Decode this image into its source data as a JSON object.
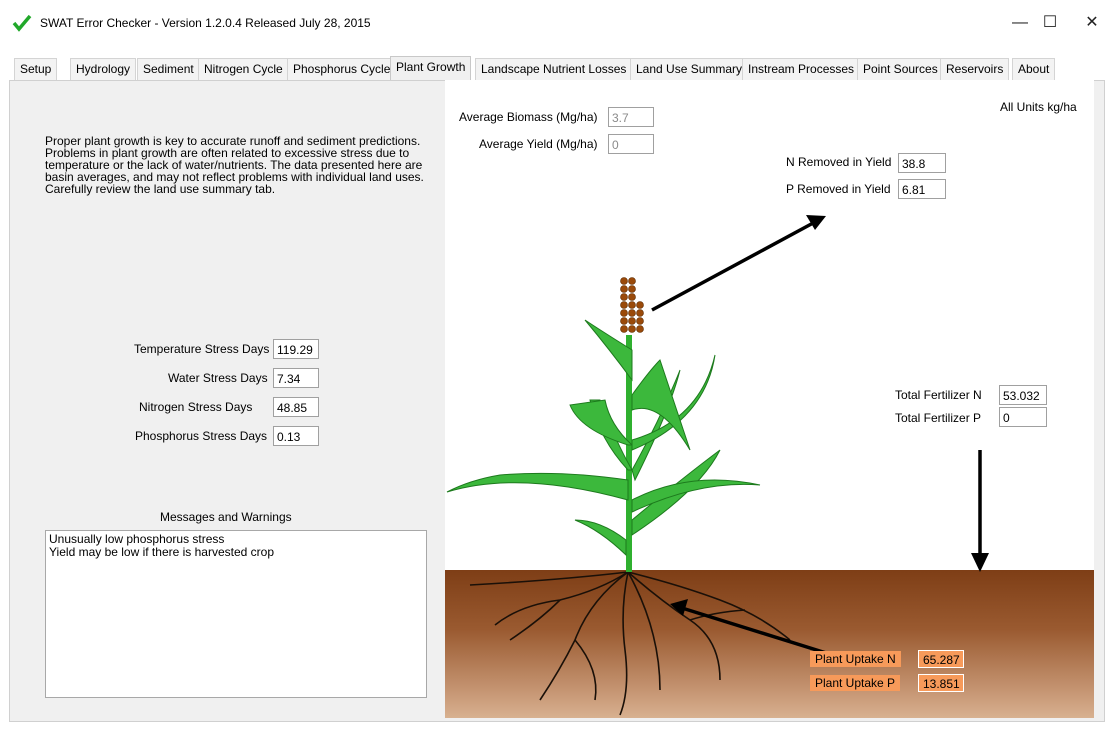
{
  "window": {
    "title": "SWAT Error Checker - Version 1.2.0.4 Released July 28, 2015",
    "minimize": "—",
    "maximize": "☐",
    "close": "✕"
  },
  "tabs": [
    "Setup",
    "Hydrology",
    "Sediment",
    "Nitrogen Cycle",
    "Phosphorus Cycle",
    "Plant Growth",
    "Landscape Nutrient Losses",
    "Land Use Summary",
    "Instream Processes",
    "Point Sources",
    "Reservoirs",
    "About"
  ],
  "active_tab": "Plant Growth",
  "intro": "Proper plant growth is key to accurate runoff and sediment predictions. Problems in plant growth are often related to excessive stress due to temperature or the lack of water/nutrients.  The data presented here are basin averages, and may not reflect problems with individual land uses. Carefully review the land use summary tab.",
  "stress": {
    "temperature_label": "Temperature Stress Days",
    "temperature": "119.29",
    "water_label": "Water Stress Days",
    "water": "7.34",
    "nitrogen_label": "Nitrogen Stress Days",
    "nitrogen": "48.85",
    "phosphorus_label": "Phosphorus Stress Days",
    "phosphorus": "0.13"
  },
  "messages": {
    "title": "Messages and Warnings",
    "line1": "Unusually low phosphorus stress",
    "line2": "Yield may be low if there is harvested crop"
  },
  "biomass": {
    "label": "Average Biomass (Mg/ha)",
    "value": "3.7"
  },
  "yield": {
    "label": "Average Yield (Mg/ha)",
    "value": "0"
  },
  "units": "All Units kg/ha",
  "n_removed": {
    "label": "N Removed in Yield",
    "value": "38.8"
  },
  "p_removed": {
    "label": "P Removed in Yield",
    "value": "6.81"
  },
  "fert_n": {
    "label": "Total Fertilizer N",
    "value": "53.032"
  },
  "fert_p": {
    "label": "Total Fertilizer P",
    "value": "0"
  },
  "uptake_n": {
    "label": "Plant Uptake N",
    "value": "65.287"
  },
  "uptake_p": {
    "label": "Plant Uptake P",
    "value": "13.851"
  },
  "colors": {
    "accent_green": "#22a020",
    "soil": "#8a4a20",
    "uptake_orange": "#f79a5a"
  }
}
